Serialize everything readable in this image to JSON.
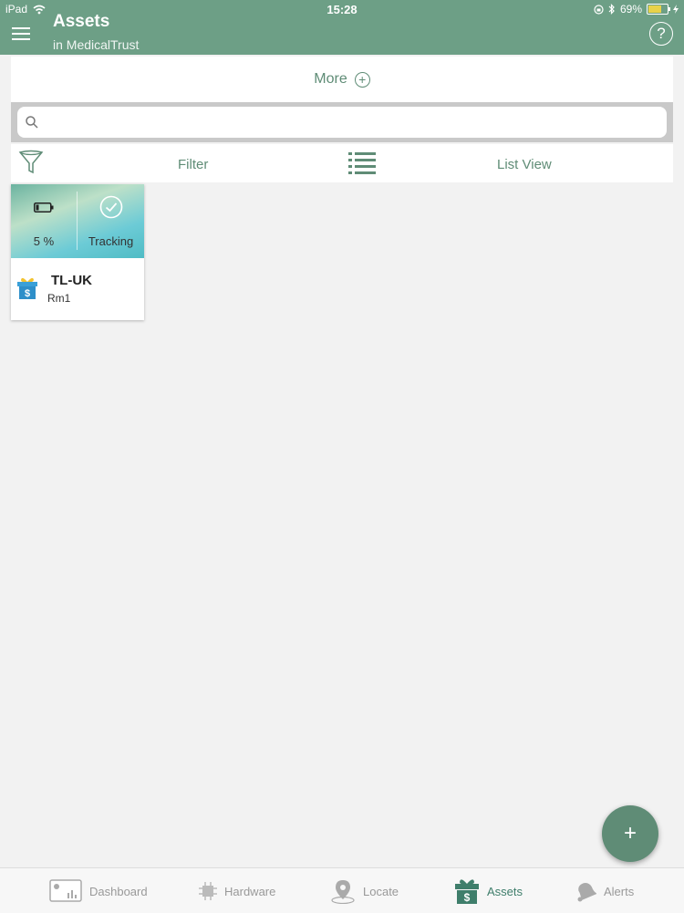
{
  "status_bar": {
    "device": "iPad",
    "time": "15:28",
    "battery": "69%"
  },
  "header": {
    "title": "Assets",
    "subtitle": "in MedicalTrust",
    "help_symbol": "?"
  },
  "more": {
    "label": "More",
    "icon": "plus-circle-icon"
  },
  "search": {
    "placeholder": "",
    "value": ""
  },
  "toolbar": {
    "filter_label": "Filter",
    "list_view_label": "List View"
  },
  "assets": [
    {
      "battery_percent": "5 %",
      "status": "Tracking",
      "name": "TL-UK",
      "location": "Rm1"
    }
  ],
  "fab": {
    "label": "+"
  },
  "tabs": [
    {
      "label": "Dashboard",
      "icon": "dashboard-icon",
      "active": false
    },
    {
      "label": "Hardware",
      "icon": "chip-icon",
      "active": false
    },
    {
      "label": "Locate",
      "icon": "location-pin-icon",
      "active": false
    },
    {
      "label": "Assets",
      "icon": "gift-dollar-icon",
      "active": true
    },
    {
      "label": "Alerts",
      "icon": "bell-icon",
      "active": false
    }
  ],
  "colors": {
    "brand": "#6d9f86",
    "accent": "#5f8c76",
    "active_tab": "#3f7e6b",
    "inactive_tab": "#999999"
  }
}
